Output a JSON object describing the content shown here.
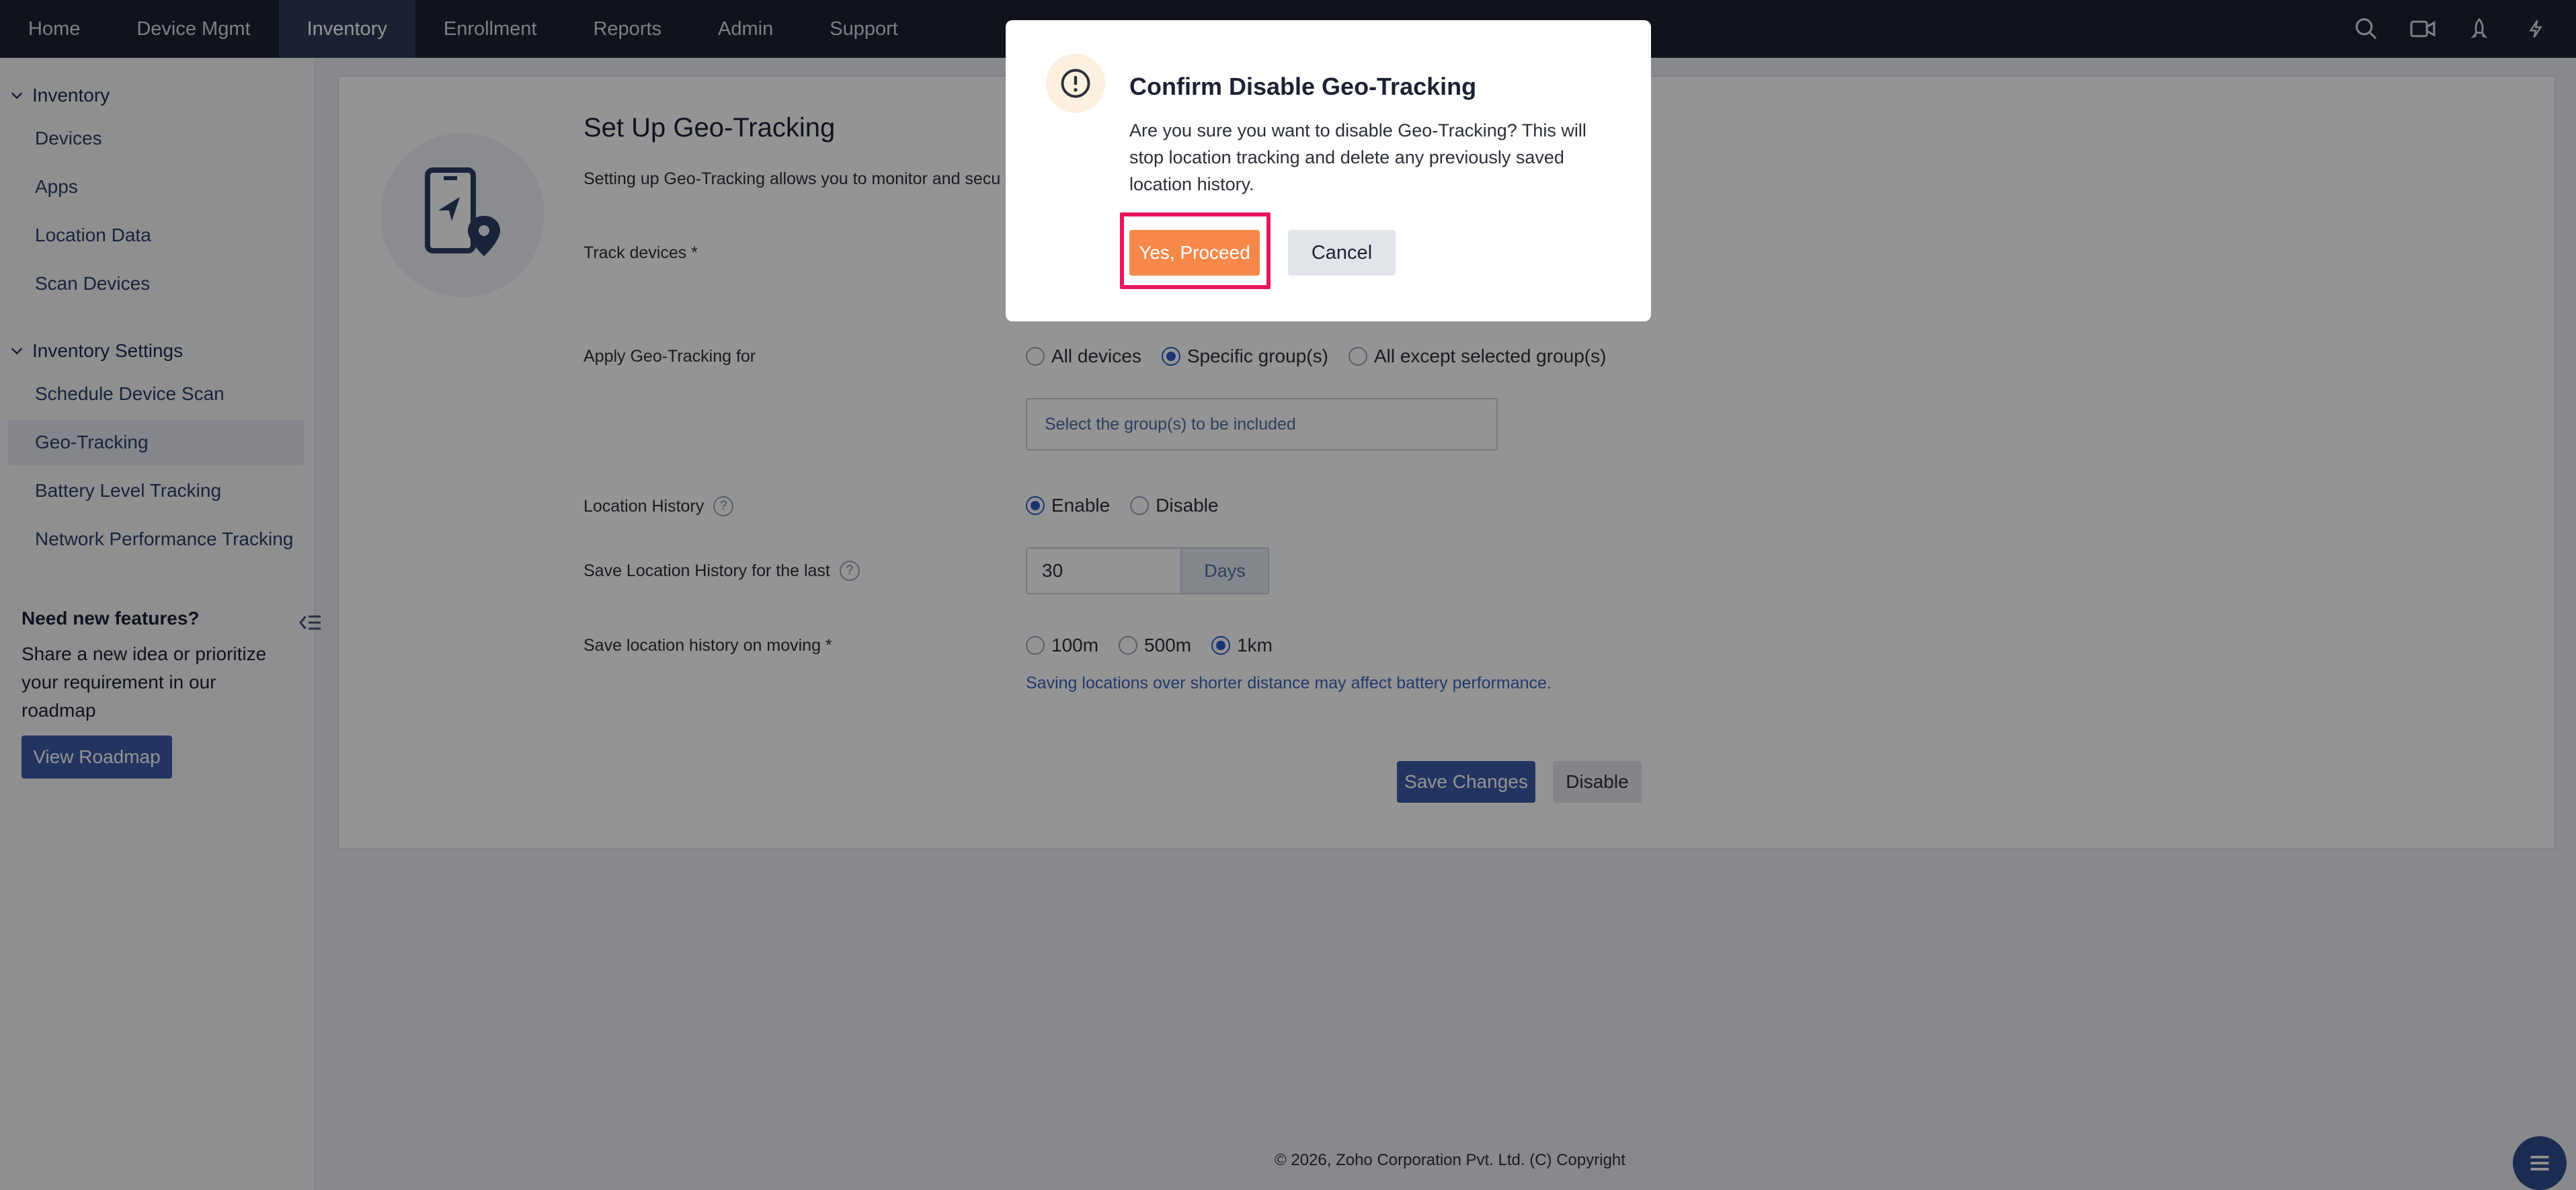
{
  "topnav": {
    "items": [
      "Home",
      "Device Mgmt",
      "Inventory",
      "Enrollment",
      "Reports",
      "Admin",
      "Support"
    ],
    "active": "Inventory",
    "right_icons": [
      "search-icon",
      "video-icon",
      "rocket-icon",
      "lightning-icon"
    ]
  },
  "sidebar": {
    "section1": "Inventory",
    "section1_items": [
      "Devices",
      "Apps",
      "Location Data",
      "Scan Devices"
    ],
    "section2": "Inventory Settings",
    "section2_items": [
      "Schedule Device Scan",
      "Geo-Tracking",
      "Battery Level Tracking",
      "Network Performance Tracking"
    ],
    "active": "Geo-Tracking",
    "promo_title": "Need new features?",
    "promo_text": "Share a new idea or prioritize your requirement in our roadmap",
    "promo_button": "View Roadmap"
  },
  "main": {
    "title": "Set Up Geo-Tracking",
    "description": "Setting up Geo-Tracking allows you to monitor and secu",
    "track_label": "Track devices *",
    "apply_label": "Apply Geo-Tracking for",
    "apply_options": [
      "All devices",
      "Specific group(s)",
      "All except selected group(s)"
    ],
    "apply_selected": "Specific group(s)",
    "group_placeholder": "Select the group(s) to be included",
    "history_label": "Location History",
    "history_options": [
      "Enable",
      "Disable"
    ],
    "history_selected": "Enable",
    "save_history_label": "Save Location History for the last",
    "days_value": "30",
    "days_unit": "Days",
    "moving_label": "Save location history on moving *",
    "moving_options": [
      "100m",
      "500m",
      "1km"
    ],
    "moving_selected": "1km",
    "moving_hint": "Saving locations over shorter distance may affect battery performance.",
    "save_button": "Save Changes",
    "disable_button": "Disable",
    "footer": "© 2026, Zoho Corporation Pvt. Ltd. (C) Copyright"
  },
  "modal": {
    "title": "Confirm Disable Geo-Tracking",
    "message": "Are you sure you want to disable Geo-Tracking? This will stop location tracking and delete any previously saved location history.",
    "proceed": "Yes, Proceed",
    "cancel": "Cancel"
  },
  "colors": {
    "nav_bg": "#1d2230",
    "primary": "#3d5aa8",
    "proceed": "#f6894a",
    "highlight": "#e8155a"
  }
}
